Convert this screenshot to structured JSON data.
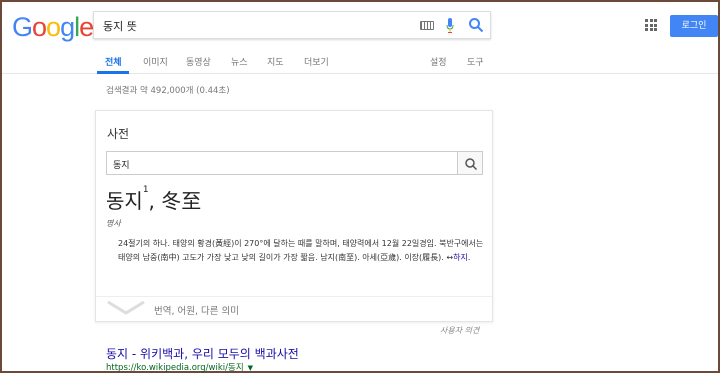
{
  "logo": {
    "letters": [
      "G",
      "o",
      "o",
      "g",
      "l",
      "e"
    ],
    "colors": [
      "#4285f4",
      "#ea4335",
      "#fbbc05",
      "#4285f4",
      "#34a853",
      "#ea4335"
    ]
  },
  "search": {
    "query": "동지 뜻"
  },
  "header": {
    "login_label": "로그인"
  },
  "tabs": [
    {
      "label": "전체"
    },
    {
      "label": "이미지"
    },
    {
      "label": "동영상"
    },
    {
      "label": "뉴스"
    },
    {
      "label": "지도"
    },
    {
      "label": "더보기"
    }
  ],
  "tools": {
    "settings": "설정",
    "tools": "도구"
  },
  "stats": "검색결과 약 492,000개 (0.44초)",
  "dictionary": {
    "title": "사전",
    "input_value": "동지",
    "headword": "동지",
    "superscript": "1",
    "hanja": ", 冬至",
    "pos": "명사",
    "definition": "24절기의 하나. 태양의 황경(黃經)이 270°에 달하는 때를 말하며, 태양력에서 12월 22일경임. 북반구에서는 태양의 남중(南中) 고도가 가장 낮고 낮의 길이가 가장 짧음. 남지(南至). 아세(亞歲). 이장(履長).",
    "antonym_prefix": " ↔",
    "antonym": "하지",
    "antonym_suffix": ".",
    "more_label": "번역, 어원, 다른 의미"
  },
  "feedback": "사용자 의견",
  "result": {
    "title": "동지 - 위키백과, 우리 모두의 백과사전",
    "url": "https://ko.wikipedia.org/wiki/동지",
    "arrow": "▼"
  }
}
